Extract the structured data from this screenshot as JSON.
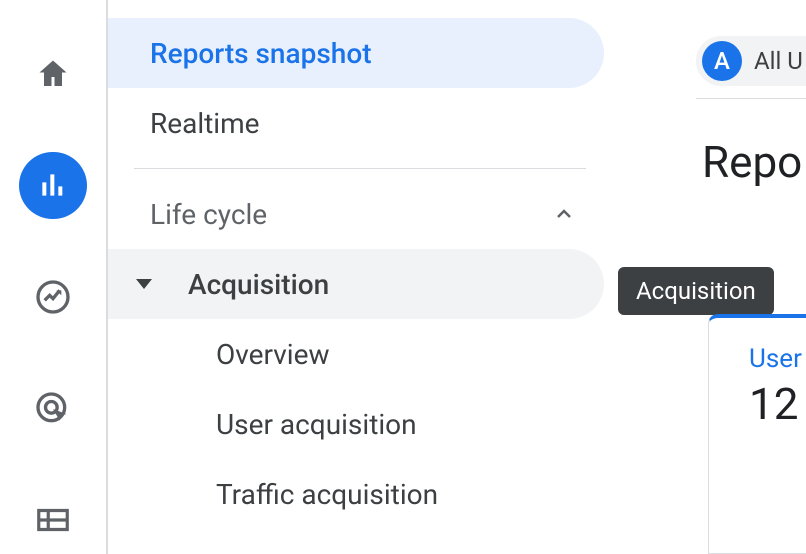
{
  "nav": {
    "reports_snapshot": "Reports snapshot",
    "realtime": "Realtime",
    "section_life_cycle": "Life cycle",
    "acquisition": "Acquisition",
    "overview": "Overview",
    "user_acquisition": "User acquisition",
    "traffic_acquisition": "Traffic acquisition"
  },
  "tooltip": {
    "acquisition": "Acquisition"
  },
  "content": {
    "audience_badge": "A",
    "audience_label": "All U",
    "page_title": "Repo",
    "metric_label": "User",
    "metric_value": "12"
  }
}
